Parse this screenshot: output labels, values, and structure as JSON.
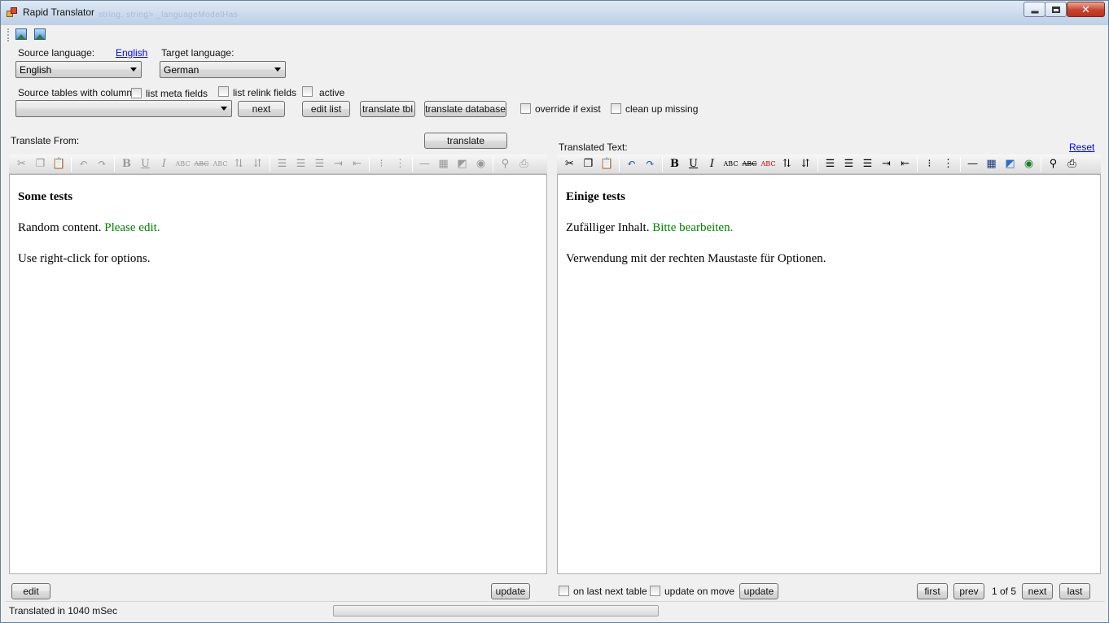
{
  "window": {
    "title": "Rapid Translator",
    "background_text": "string, string>  _languageModelHas"
  },
  "controls": {
    "source_language_label": "Source language:",
    "source_language_link": "English",
    "source_language_value": "English",
    "target_language_label": "Target language:",
    "target_language_value": "German",
    "source_tables_label": "Source tables with column:",
    "list_meta_fields": "list meta fields",
    "list_relink_fields": "list relink fields",
    "active": "active",
    "source_tables_value": "",
    "next": "next",
    "edit_list": "edit list",
    "translate_tbl": "translate tbl",
    "translate_database": "translate database",
    "override_if_exist": "override if exist",
    "clean_up_missing": "clean up missing",
    "translate_from_label": "Translate From:",
    "translate": "translate",
    "translated_text_label": "Translated Text:",
    "reset": "Reset"
  },
  "source": {
    "heading": "Some tests",
    "line1_plain": "Random content.",
    "line1_green": "Please edit.",
    "line2": "Use right-click for options."
  },
  "target": {
    "heading": "Einige tests",
    "line1_plain": "Zufälliger Inhalt.",
    "line1_green": "Bitte bearbeiten.",
    "line2": "Verwendung mit der rechten Maustaste für Optionen."
  },
  "bottom": {
    "edit": "edit",
    "update_left": "update",
    "on_last_next_table": "on last next table",
    "update_on_move": "update on move",
    "update_right": "update",
    "first": "first",
    "prev": "prev",
    "page_info": "1 of 5",
    "next": "next",
    "last": "last"
  },
  "status": {
    "text": "Translated in 1040 mSec",
    "progress": 0.0
  },
  "toolbar_icons": [
    "cut-icon",
    "copy-icon",
    "paste-icon",
    "undo-icon",
    "redo-icon",
    "bold-icon",
    "underline-icon",
    "italic-icon",
    "strikethrough-icon",
    "strikethrough2-icon",
    "spellcheck-icon",
    "sort-asc-icon",
    "sort-desc-icon",
    "align-left-icon",
    "align-center-icon",
    "align-right-icon",
    "indent-icon",
    "outdent-icon",
    "bullet-list-icon",
    "numbered-list-icon",
    "horizontal-rule-icon",
    "table-icon",
    "image-icon",
    "link-icon",
    "find-icon",
    "print-icon"
  ],
  "toolbar_glyphs": {
    "bold": "B",
    "underline": "U",
    "italic": "I",
    "abc": "ABC"
  },
  "colors": {
    "green_text": "#008000",
    "link_blue": "#0000ff",
    "chrome_gray": "#f0f0f0"
  }
}
